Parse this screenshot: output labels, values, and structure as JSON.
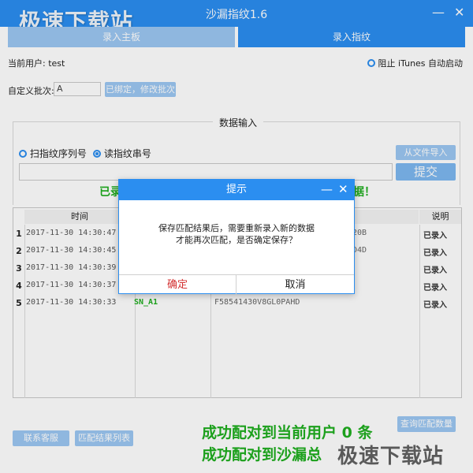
{
  "window": {
    "title": "沙漏指纹1.6",
    "minimize": "—",
    "close": "✕"
  },
  "watermark": {
    "top": "极速下载站",
    "bottom": "极速下载站"
  },
  "tabs": [
    "录入主板",
    "录入指纹"
  ],
  "user": {
    "label": "当前用户: ",
    "name": "test"
  },
  "itunes_option": {
    "label": "阻止 iTunes 自动启动"
  },
  "batch": {
    "label": "自定义批次:",
    "value": "A",
    "button": "已绑定，修改批次"
  },
  "data_input": {
    "title": "数据输入",
    "radio_scan": "扫指纹序列号",
    "radio_read": "读指纹串号",
    "import_button": "从文件导入",
    "submit_button": "提交",
    "status_left": "已录",
    "status_right": "据！"
  },
  "table": {
    "headers": [
      "时间",
      "说明"
    ],
    "rows": [
      {
        "num": "1",
        "time": "2017-11-30 14:30:47",
        "sn": "",
        "fp": "20B",
        "note": "已录入"
      },
      {
        "num": "2",
        "time": "2017-11-30 14:30:45",
        "sn": "",
        "fp": "D4D",
        "note": "已录入"
      },
      {
        "num": "3",
        "time": "2017-11-30 14:30:39",
        "sn": "",
        "fp": "",
        "note": "已录入"
      },
      {
        "num": "4",
        "time": "2017-11-30 14:30:37",
        "sn": "",
        "fp": "",
        "note": "已录入"
      },
      {
        "num": "5",
        "time": "2017-11-30 14:30:33",
        "sn": "SN_A1",
        "fp": "F58541430V8GL0PAHD",
        "note": "已录入"
      }
    ]
  },
  "dialog": {
    "title": "提示",
    "line1": "保存匹配结果后，需要重新录入新的数据",
    "line2": "才能再次匹配，是否确定保存？",
    "confirm": "确定",
    "cancel": "取消"
  },
  "footer": {
    "contact_button": "联系客服",
    "list_button": "匹配结果列表",
    "query_button": "查询匹配数量",
    "match_user": "成功配对到当前用户 0 条",
    "match_total": "成功配对到沙漏总"
  }
}
